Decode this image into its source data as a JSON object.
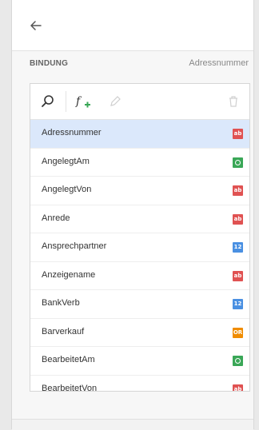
{
  "section": {
    "label": "BINDUNG",
    "value": "Adressnummer"
  },
  "toolbar": {
    "search_icon": "search-icon",
    "add_function_icon": "function-add-icon",
    "edit_icon": "pencil-icon",
    "delete_icon": "trash-icon"
  },
  "fields": [
    {
      "label": "Adressnummer",
      "type": "ab",
      "color": "#e05252",
      "selected": true
    },
    {
      "label": "AngelegtAm",
      "type": "clock",
      "color": "#3aa757",
      "selected": false
    },
    {
      "label": "AngelegtVon",
      "type": "ab",
      "color": "#e05252",
      "selected": false
    },
    {
      "label": "Anrede",
      "type": "ab",
      "color": "#e05252",
      "selected": false
    },
    {
      "label": "Ansprechpartner",
      "type": "12",
      "color": "#4a90e2",
      "selected": false
    },
    {
      "label": "Anzeigename",
      "type": "ab",
      "color": "#e05252",
      "selected": false
    },
    {
      "label": "BankVerb",
      "type": "12",
      "color": "#4a90e2",
      "selected": false
    },
    {
      "label": "Barverkauf",
      "type": "OR",
      "color": "#f08c00",
      "selected": false
    },
    {
      "label": "BearbeitetAm",
      "type": "clock",
      "color": "#3aa757",
      "selected": false
    },
    {
      "label": "BearbeitetVon",
      "type": "ab",
      "color": "#e05252",
      "selected": false
    }
  ]
}
